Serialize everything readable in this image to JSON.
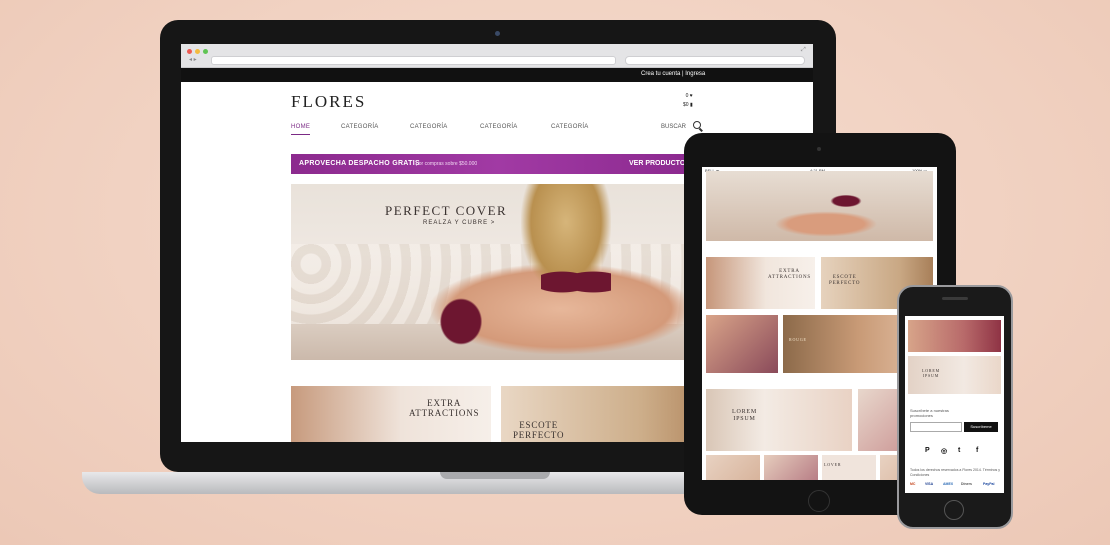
{
  "laptop": {
    "header": {
      "account_links": "Crea tu cuenta  |  Ingresa",
      "logo": "FLORES",
      "wishlist_count": "0 ♥",
      "cart_total": "$0 ▮"
    },
    "nav": [
      {
        "label": "HOME",
        "active": true
      },
      {
        "label": "CATEGORÍA"
      },
      {
        "label": "CATEGORÍA"
      },
      {
        "label": "CATEGORÍA"
      },
      {
        "label": "CATEGORÍA"
      }
    ],
    "search_label": "BUSCAR",
    "promo": {
      "title": "APROVECHA DESPACHO GRATIS",
      "subtitle": "por compras sobre $50.000",
      "cta": "VER PRODUCTO"
    },
    "hero": {
      "title": "PERFECT COVER",
      "subtitle": "REALZA Y CUBRE >"
    },
    "tiles": [
      {
        "label": "EXTRA\nATTRACTIONS"
      },
      {
        "label": "ESCOTE\nPERFECTO"
      }
    ]
  },
  "tablet": {
    "status": {
      "carrier": "BELL ᯤ",
      "time": "4:21 PM",
      "battery": "100% ▭"
    },
    "tiles": [
      {
        "label": "EXTRA\nATTRACTIONS"
      },
      {
        "label": "ESCOTE\nPERFECTO"
      },
      {
        "label": "ROUGE"
      },
      {
        "label": "LOREM\nIPSUM"
      },
      {
        "label": "LOVER"
      }
    ]
  },
  "phone": {
    "tiles": [
      {
        "label": "LOREM\nIPSUM"
      }
    ],
    "subscribe_text": "Suscríbete a nuestras promociones",
    "email_placeholder": "",
    "subscribe_button": "Suscríbeme",
    "social": [
      "P",
      "◎",
      "t",
      "f"
    ],
    "footer": "Todos los derechos reservados a Flores 2014.  Términos y Condiciones",
    "payments": [
      "MC",
      "VISA",
      "AMEX",
      "Diners",
      "PayPal"
    ]
  },
  "colors": {
    "accent": "#7b2a85",
    "promo": "#9b2f9e",
    "background": "#f1d2c2"
  }
}
